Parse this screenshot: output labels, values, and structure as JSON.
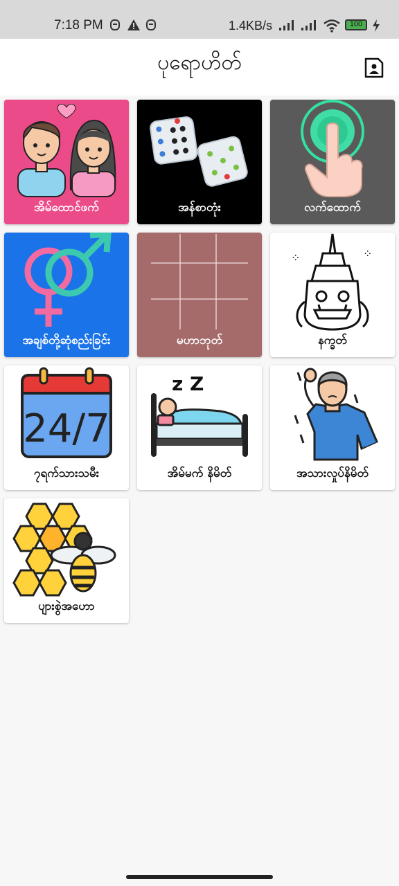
{
  "status_bar": {
    "time": "7:18 PM",
    "net_speed": "1.4KB/s",
    "battery": "100",
    "icons": [
      "face-icon",
      "warning-icon",
      "face-icon",
      "signal-icon",
      "signal-icon",
      "wifi-icon",
      "battery-icon",
      "charging-icon"
    ]
  },
  "app_bar": {
    "title": "ပုရောဟိတ်",
    "action_icon": "contact-icon"
  },
  "tiles": [
    {
      "label": "အိမ်ထောင်ဖက်",
      "icon": "couple-icon",
      "bg": "#ec4b8a"
    },
    {
      "label": "အန်စာတုံး",
      "icon": "dice-icon",
      "bg": "#000000"
    },
    {
      "label": "လက်ထောက်",
      "icon": "tap-hand-icon",
      "bg": "#5a5a5a"
    },
    {
      "label": "အချစ်တို့ဆုံစည်းခြင်း",
      "icon": "gender-icon",
      "bg": "#1a73e8"
    },
    {
      "label": "မဟာဘုတ်",
      "icon": "grid-board-icon",
      "bg": "#a56b6b"
    },
    {
      "label": "နက္ခတ်",
      "icon": "giant-mask-icon",
      "bg": "#ffffff"
    },
    {
      "label": "၇ရက်သားသမီး",
      "icon": "calendar-24-7-icon",
      "bg": "#ffffff"
    },
    {
      "label": "အိမ်မက် နိမိတ်",
      "icon": "sleeping-bed-icon",
      "bg": "#ffffff"
    },
    {
      "label": "အသားလှုပ်နိမိတ်",
      "icon": "man-headache-icon",
      "bg": "#ffffff"
    },
    {
      "label": "ပျားစွဲအဟော",
      "icon": "bee-honeycomb-icon",
      "bg": "#ffffff"
    }
  ],
  "calendar_text": "24/7",
  "sleep_text": "z Z"
}
